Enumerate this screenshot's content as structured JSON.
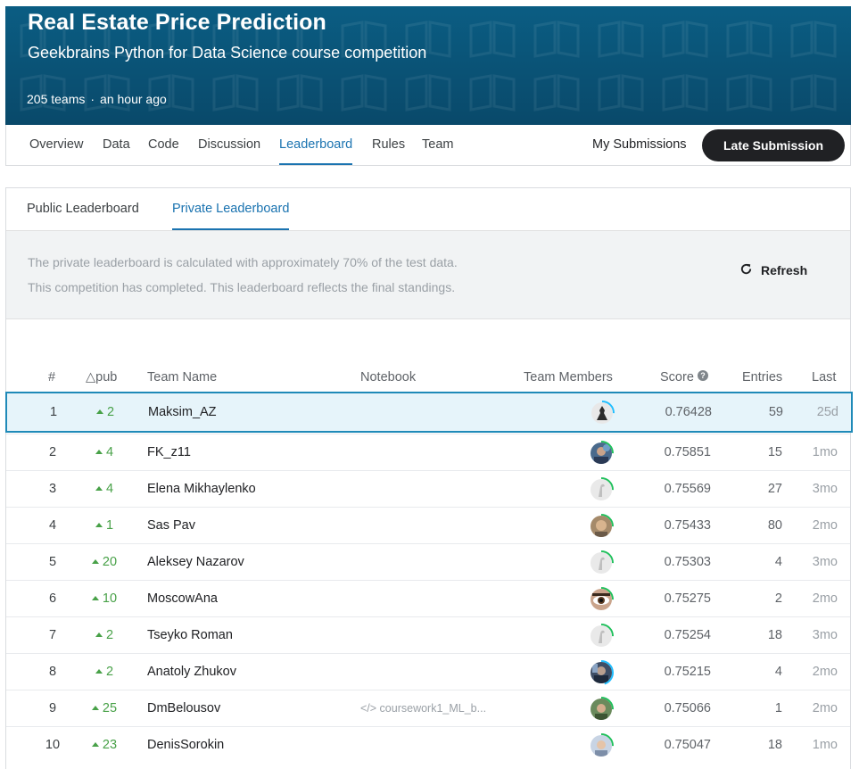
{
  "competition": {
    "title": "Real Estate Price Prediction",
    "subtitle": "Geekbrains Python for Data Science course competition",
    "teams": "205 teams",
    "separator": "·",
    "updated": "an hour ago"
  },
  "nav": {
    "tabs": [
      "Overview",
      "Data",
      "Code",
      "Discussion",
      "Leaderboard",
      "Rules",
      "Team"
    ],
    "active": "Leaderboard",
    "my_submissions": "My Submissions",
    "late_submission": "Late Submission"
  },
  "leaderboard": {
    "tabs": [
      "Public Leaderboard",
      "Private Leaderboard"
    ],
    "active_tab": "Private Leaderboard",
    "info_line_1": "The private leaderboard is calculated with approximately 70% of the test data.",
    "info_line_2": "This competition has completed. This leaderboard reflects the final standings.",
    "refresh_label": "Refresh",
    "columns": {
      "rank": "#",
      "delta": "△pub",
      "team": "Team Name",
      "notebook": "Notebook",
      "members": "Team Members",
      "score": "Score",
      "entries": "Entries",
      "last": "Last"
    },
    "rows": [
      {
        "rank": "1",
        "delta": "2",
        "team": "Maksim_AZ",
        "notebook": "",
        "score": "0.76428",
        "entries": "59",
        "last": "25d",
        "avatar": "dark-figure",
        "ring_color": "#20beff",
        "ring_fraction": 0.25
      },
      {
        "rank": "2",
        "delta": "4",
        "team": "FK_z11",
        "notebook": "",
        "score": "0.75851",
        "entries": "15",
        "last": "1mo",
        "avatar": "blue-photo",
        "ring_color": "#20c05c",
        "ring_fraction": 0.25
      },
      {
        "rank": "3",
        "delta": "4",
        "team": "Elena Mikhaylenko",
        "notebook": "",
        "score": "0.75569",
        "entries": "27",
        "last": "3mo",
        "avatar": "default-goose",
        "ring_color": "#20c05c",
        "ring_fraction": 0.25
      },
      {
        "rank": "4",
        "delta": "1",
        "team": "Sas Pav",
        "notebook": "",
        "score": "0.75433",
        "entries": "80",
        "last": "2mo",
        "avatar": "tan-photo",
        "ring_color": "#20c05c",
        "ring_fraction": 0.25
      },
      {
        "rank": "5",
        "delta": "20",
        "team": "Aleksey Nazarov",
        "notebook": "",
        "score": "0.75303",
        "entries": "4",
        "last": "3mo",
        "avatar": "default-goose",
        "ring_color": "#20c05c",
        "ring_fraction": 0.25
      },
      {
        "rank": "6",
        "delta": "10",
        "team": "MoscowAna",
        "notebook": "",
        "score": "0.75275",
        "entries": "2",
        "last": "2mo",
        "avatar": "eye-photo",
        "ring_color": "#20c05c",
        "ring_fraction": 0.25
      },
      {
        "rank": "7",
        "delta": "2",
        "team": "Tseyko Roman",
        "notebook": "",
        "score": "0.75254",
        "entries": "18",
        "last": "3mo",
        "avatar": "default-goose",
        "ring_color": "#20c05c",
        "ring_fraction": 0.25
      },
      {
        "rank": "8",
        "delta": "2",
        "team": "Anatoly Zhukov",
        "notebook": "",
        "score": "0.75215",
        "entries": "4",
        "last": "2mo",
        "avatar": "dark-blue-photo",
        "ring_color": "#20beff",
        "ring_fraction": 0.45
      },
      {
        "rank": "9",
        "delta": "25",
        "team": "DmBelousov",
        "notebook": "</> coursework1_ML_b...",
        "score": "0.75066",
        "entries": "1",
        "last": "2mo",
        "avatar": "green-photo",
        "ring_color": "#20c05c",
        "ring_fraction": 0.25
      },
      {
        "rank": "10",
        "delta": "23",
        "team": "DenisSorokin",
        "notebook": "",
        "score": "0.75047",
        "entries": "18",
        "last": "1mo",
        "avatar": "light-photo",
        "ring_color": "#20c05c",
        "ring_fraction": 0.25
      }
    ]
  },
  "colors": {
    "banner": "#0b5d83",
    "accent": "#1a73b0",
    "positive": "#48a148",
    "highlight_bg": "#e6f4fa",
    "highlight_border": "#1f8ab8"
  },
  "icons": {
    "refresh": "refresh-icon",
    "score_help": "help-circle-icon",
    "delta_up": "triangle-up-icon"
  }
}
